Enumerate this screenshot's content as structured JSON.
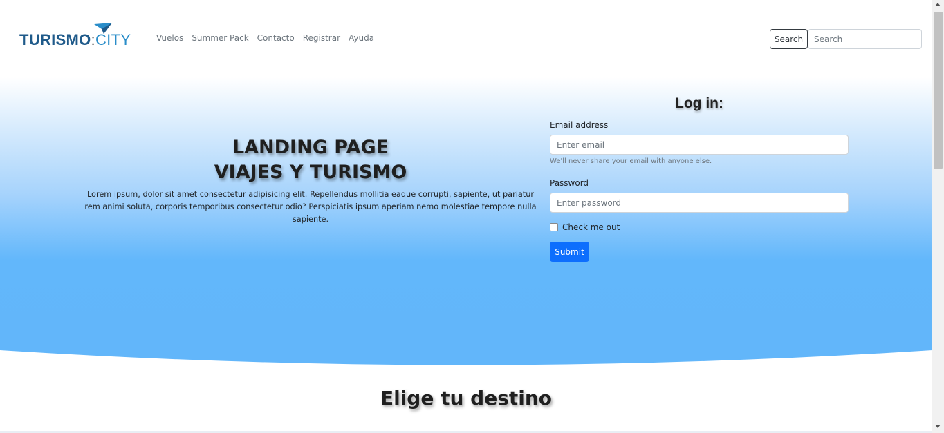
{
  "brand": {
    "name_bold": "TURISMO",
    "name_light": "CITY",
    "icon": "paper-plane-icon",
    "colors": {
      "bold": "#1f5a8a",
      "light": "#2a8dc9"
    }
  },
  "nav": {
    "links": [
      "Vuelos",
      "Summer Pack",
      "Contacto",
      "Registrar",
      "Ayuda"
    ],
    "search_button": "Search",
    "search_placeholder": "Search"
  },
  "hero": {
    "title_line1": "LANDING PAGE",
    "title_line2": "VIAJES Y TURISMO",
    "text": "Lorem ipsum, dolor sit amet consectetur adipisicing elit. Repellendus mollitia eaque corrupti, sapiente, ut pariatur rem animi soluta, corporis temporibus consectetur odio? Perspiciatis ipsum aperiam nemo molestiae tempore nulla sapiente.",
    "gradient_colors": [
      "#ffffff",
      "#a6d3fc",
      "#62b7fb"
    ]
  },
  "login": {
    "title": "Log in:",
    "email_label": "Email address",
    "email_placeholder": "Enter email",
    "email_help": "We'll never share your email with anyone else.",
    "password_label": "Password",
    "password_placeholder": "Enter password",
    "checkbox_label": "Check me out",
    "submit_label": "Submit",
    "submit_color": "#0d6efd"
  },
  "section": {
    "title": "Elige tu destino"
  }
}
